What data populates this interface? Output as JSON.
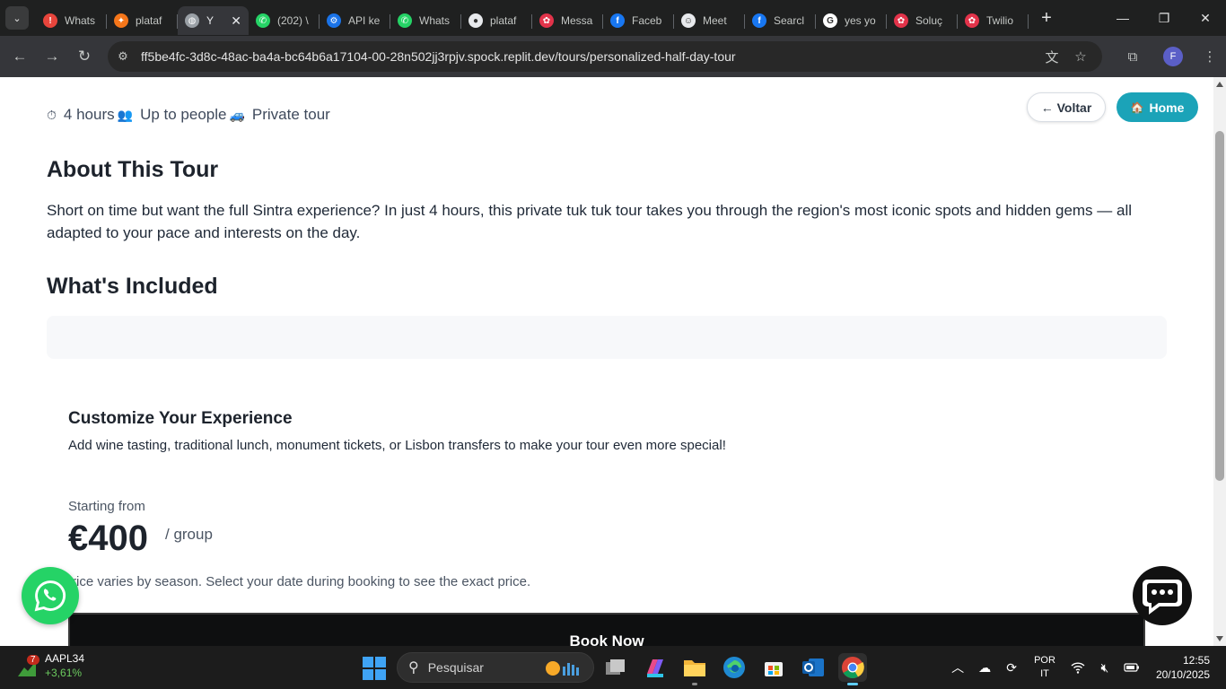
{
  "browser": {
    "tabs": [
      {
        "label": "Whats",
        "fav_color": "#e8453c",
        "fav_glyph": "!"
      },
      {
        "label": "plataf",
        "fav_color": "#f5761a",
        "fav_glyph": "✦"
      },
      {
        "label": "Y",
        "fav_color": "#9aa0a6",
        "fav_glyph": "◍",
        "active": true
      },
      {
        "label": "(202) \\",
        "fav_color": "#25d366",
        "fav_glyph": "✆"
      },
      {
        "label": "API ke",
        "fav_color": "#1a73e8",
        "fav_glyph": "⚙"
      },
      {
        "label": "Whats",
        "fav_color": "#25d366",
        "fav_glyph": "✆"
      },
      {
        "label": "plataf",
        "fav_color": "#e8eaed",
        "fav_glyph": "●"
      },
      {
        "label": "Messa",
        "fav_color": "#e2334a",
        "fav_glyph": "✿"
      },
      {
        "label": "Faceb",
        "fav_color": "#1877f2",
        "fav_glyph": "f"
      },
      {
        "label": "Meet",
        "fav_color": "#e8eaed",
        "fav_glyph": "☺"
      },
      {
        "label": "Searcl",
        "fav_color": "#1877f2",
        "fav_glyph": "f"
      },
      {
        "label": "yes yo",
        "fav_color": "#ffffff",
        "fav_glyph": "G"
      },
      {
        "label": "Soluç",
        "fav_color": "#e2334a",
        "fav_glyph": "✿"
      },
      {
        "label": "Twilio",
        "fav_color": "#e2334a",
        "fav_glyph": "✿"
      }
    ],
    "url": "ff5be4fc-3d8c-48ac-ba4a-bc64b6a17104-00-28n502jj3rpjv.spock.replit.dev/tours/personalized-half-day-tour",
    "profile_initial": "F"
  },
  "page": {
    "meta": {
      "duration_icon": "⏱",
      "duration": "4 hours",
      "people_icon": "👥",
      "people": "Up to people",
      "private_icon": "🚙",
      "private": "Private tour"
    },
    "nav": {
      "back_label": "← Voltar",
      "home_icon": "🏠",
      "home_label": "Home"
    },
    "about": {
      "title": "About This Tour",
      "text": "Short on time but want the full Sintra experience? In just 4 hours, this private tuk tuk tour takes you through the region's most iconic spots and hidden gems — all adapted to your pace and interests on the day."
    },
    "included": {
      "title": "What's Included"
    },
    "customize": {
      "title": "Customize Your Experience",
      "text": "Add wine tasting, traditional lunch, monument tickets, or Lisbon transfers to make your tour even more special!"
    },
    "pricing": {
      "starting_from": "Starting from",
      "price": "€400",
      "per": "/ group",
      "note": "Price varies by season. Select your date during booking to see the exact price."
    },
    "book_label": "Book Now",
    "colors": {
      "accent": "#1ba3b8",
      "whatsapp": "#25d366"
    }
  },
  "taskbar": {
    "stock_badge": "7",
    "stock_name": "AAPL34",
    "stock_change": "+3,61%",
    "search_placeholder": "Pesquisar",
    "lang_top": "POR",
    "lang_bottom": "IT",
    "time": "12:55",
    "date": "20/10/2025"
  }
}
